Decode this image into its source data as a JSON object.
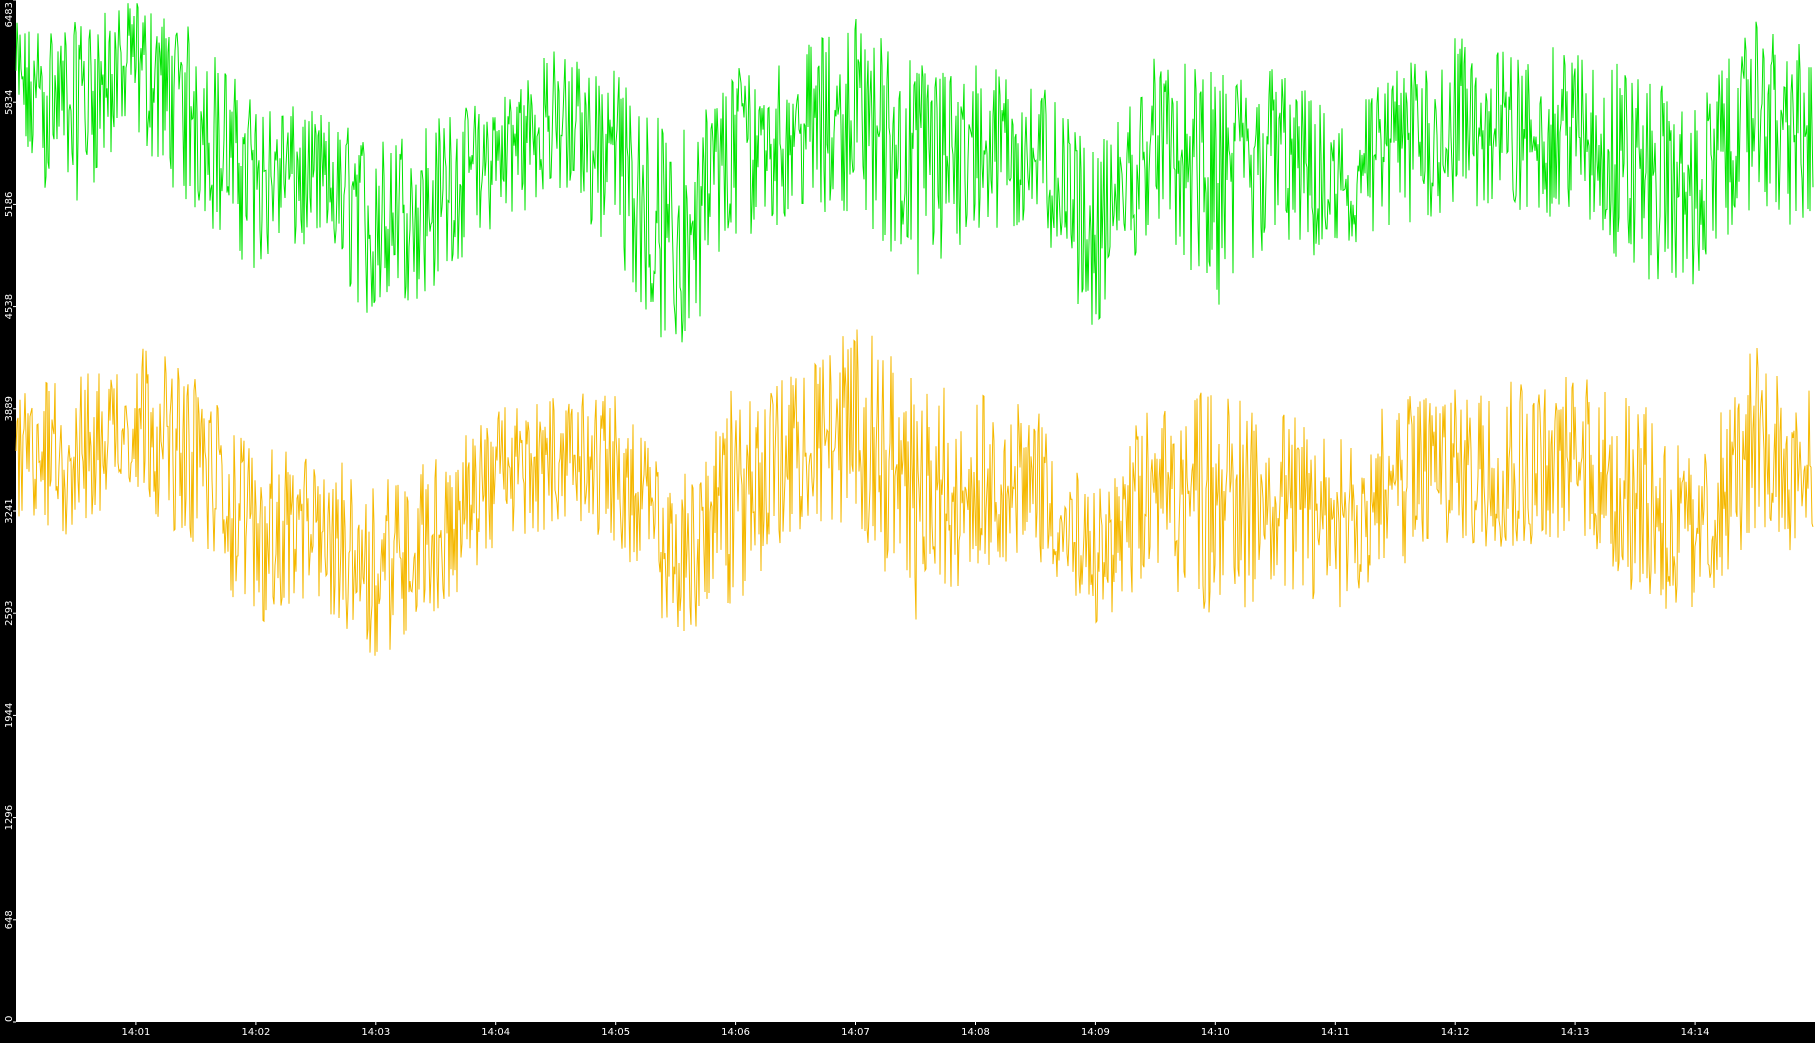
{
  "chart_data": {
    "type": "line",
    "title": "",
    "xlabel": "",
    "ylabel": "",
    "ylim": [
      0,
      6483
    ],
    "y_ticks": [
      "0",
      "648",
      "1296",
      "1944",
      "2593",
      "3241",
      "3889",
      "4538",
      "5186",
      "5834",
      "6483"
    ],
    "x_ticks": [
      "14:01",
      "14:02",
      "14:03",
      "14:04",
      "14:05",
      "14:06",
      "14:07",
      "14:08",
      "14:09",
      "14:10",
      "14:11",
      "14:12",
      "14:13",
      "14:14"
    ],
    "x_range": [
      "14:00",
      "14:15"
    ],
    "grid": false,
    "legend": "none",
    "background": "#ffffff",
    "series": [
      {
        "color": "#00e400",
        "x": [
          "14:00",
          "14:00:30",
          "14:01",
          "14:01:30",
          "14:02",
          "14:02:30",
          "14:03",
          "14:03:30",
          "14:04",
          "14:04:30",
          "14:05",
          "14:05:30",
          "14:06",
          "14:06:30",
          "14:07",
          "14:07:30",
          "14:08",
          "14:08:30",
          "14:09",
          "14:09:30",
          "14:10",
          "14:10:30",
          "14:11",
          "14:11:30",
          "14:12",
          "14:12:30",
          "14:13",
          "14:13:30",
          "14:14",
          "14:14:30",
          "14:15"
        ],
        "values": [
          5900,
          5850,
          6100,
          5750,
          5400,
          5350,
          5000,
          5250,
          5450,
          5750,
          5550,
          4800,
          5600,
          5650,
          5750,
          5500,
          5550,
          5500,
          4850,
          5600,
          5250,
          5550,
          5200,
          5550,
          5650,
          5600,
          5600,
          5450,
          5200,
          5800,
          5550
        ],
        "low": [
          5350,
          5200,
          5600,
          5100,
          4750,
          4900,
          4400,
          4650,
          5050,
          5250,
          4850,
          4150,
          4950,
          5100,
          5150,
          4650,
          4900,
          5050,
          4350,
          5100,
          4400,
          4950,
          4700,
          4950,
          5150,
          5100,
          5100,
          4700,
          4650,
          5200,
          4900
        ],
        "high": [
          6300,
          6300,
          6450,
          6250,
          5800,
          5750,
          5550,
          5700,
          5850,
          6150,
          6000,
          5550,
          6050,
          6100,
          6350,
          6050,
          6050,
          5950,
          5450,
          6100,
          5950,
          6050,
          5700,
          6000,
          6200,
          6100,
          6150,
          6000,
          5750,
          6300,
          6100
        ]
      },
      {
        "color": "#f5b800",
        "x": [
          "14:00",
          "14:00:30",
          "14:01",
          "14:01:30",
          "14:02",
          "14:02:30",
          "14:03",
          "14:03:30",
          "14:04",
          "14:04:30",
          "14:05",
          "14:05:30",
          "14:06",
          "14:06:30",
          "14:07",
          "14:07:30",
          "14:08",
          "14:08:30",
          "14:09",
          "14:09:30",
          "14:10",
          "14:10:30",
          "14:11",
          "14:11:30",
          "14:12",
          "14:12:30",
          "14:13",
          "14:13:30",
          "14:14",
          "14:14:30",
          "14:15"
        ],
        "values": [
          3600,
          3550,
          3850,
          3500,
          3150,
          3100,
          2900,
          3050,
          3450,
          3600,
          3550,
          2800,
          3450,
          3550,
          3650,
          3300,
          3350,
          3400,
          2800,
          3400,
          3350,
          3300,
          3150,
          3400,
          3500,
          3500,
          3550,
          3350,
          3050,
          3650,
          3400
        ],
        "low": [
          3100,
          3050,
          3350,
          2950,
          2500,
          2650,
          2300,
          2550,
          3000,
          3150,
          3050,
          2400,
          2650,
          3050,
          3150,
          2550,
          2850,
          2950,
          2500,
          2850,
          2500,
          2750,
          2600,
          2850,
          3000,
          3000,
          3000,
          2650,
          2550,
          3100,
          2900
        ],
        "high": [
          4000,
          4050,
          4300,
          4050,
          3600,
          3550,
          3450,
          3550,
          3850,
          3950,
          3950,
          3350,
          4000,
          4050,
          4400,
          4000,
          3950,
          3850,
          3300,
          3950,
          3950,
          3850,
          3650,
          3900,
          4050,
          4100,
          4050,
          3950,
          3500,
          4250,
          3950
        ]
      }
    ]
  }
}
